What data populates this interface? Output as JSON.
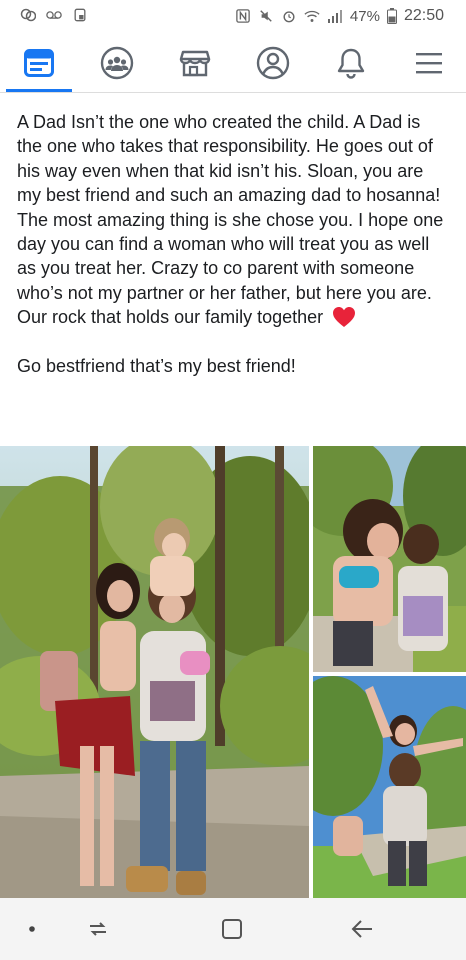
{
  "status_bar": {
    "battery": "47%",
    "time": "22:50",
    "icons": [
      "chat-icon",
      "voicemail-icon",
      "gallery-icon",
      "nfc-icon",
      "mute-icon",
      "alarm-icon",
      "wifi-icon",
      "signal-icon",
      "battery-icon"
    ]
  },
  "nav": {
    "tabs": [
      {
        "name": "news-feed-icon",
        "active": true
      },
      {
        "name": "groups-icon",
        "active": false
      },
      {
        "name": "marketplace-icon",
        "active": false
      },
      {
        "name": "profile-icon",
        "active": false
      },
      {
        "name": "notifications-icon",
        "active": false
      },
      {
        "name": "menu-icon",
        "active": false
      }
    ],
    "accent": "#1877f2"
  },
  "post": {
    "text": "A Dad Isn’t the one who created the child. A Dad is the one who takes that responsibility. He goes out of his way even when that kid isn’t his. Sloan, you are my best friend and such an amazing dad to hosanna! The most amazing thing is she chose you. I hope one day you can find a woman who will treat you as well as you treat her. Crazy to co parent with someone who’s not my partner or her father, but here you are. Our rock that holds our family together",
    "emoji": "red-heart-icon",
    "text2": "Go bestfriend that’s my best friend!"
  },
  "bottom_nav": {
    "buttons": [
      "dot-icon",
      "recents-icon",
      "home-icon",
      "back-icon"
    ]
  }
}
